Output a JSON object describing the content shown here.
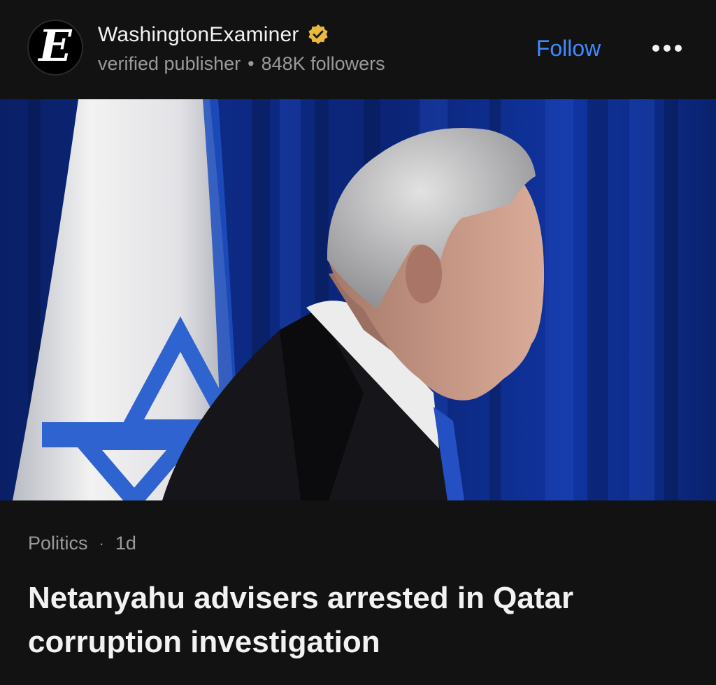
{
  "publisher": {
    "name": "WashingtonExaminer",
    "logo_letter": "E",
    "verified": true,
    "verified_icon": "verified-badge-icon",
    "type": "verified publisher",
    "separator": "•",
    "followers": "848K followers"
  },
  "actions": {
    "follow_label": "Follow",
    "more_icon": "more-horizontal-icon"
  },
  "article": {
    "category": "Politics",
    "separator": "·",
    "age": "1d",
    "headline": "Netanyahu advisers arrested in Qatar corruption investigation"
  },
  "colors": {
    "background": "#121212",
    "accent": "#3d8bfd",
    "badge": "#e8b93c",
    "secondary_text": "#9a9a9a",
    "primary_text": "#f2f2f2"
  }
}
